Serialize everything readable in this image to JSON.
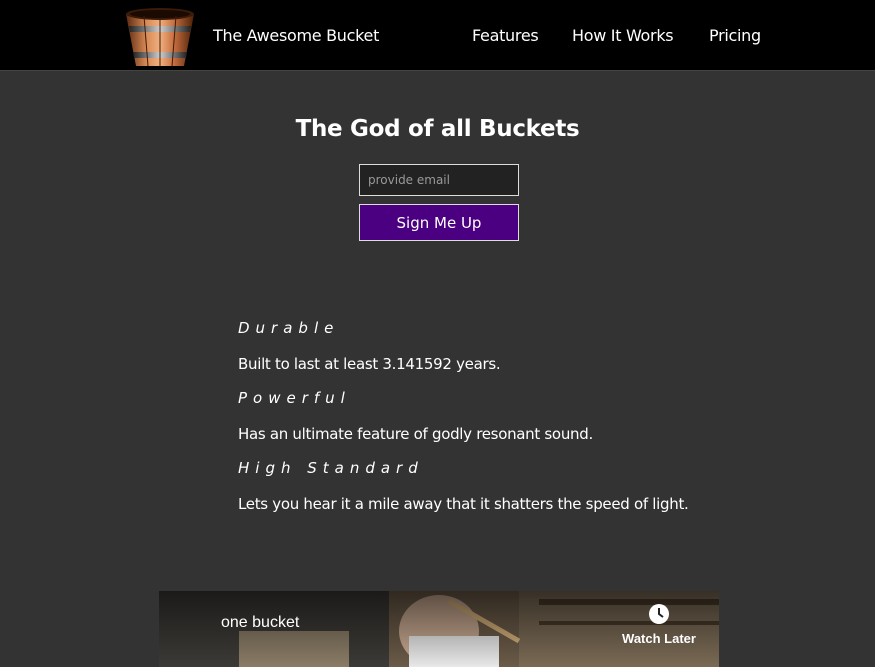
{
  "header": {
    "brand": "The Awesome Bucket",
    "nav": {
      "features": "Features",
      "how_it_works": "How It Works",
      "pricing": "Pricing"
    }
  },
  "hero": {
    "title": "The God of all Buckets",
    "email_placeholder": "provide email",
    "signup_label": "Sign Me Up"
  },
  "features": [
    {
      "heading": "Durable",
      "text": "Built to last at least 3.141592 years."
    },
    {
      "heading": "Powerful",
      "text": "Has an ultimate feature of godly resonant sound."
    },
    {
      "heading": "High Standard",
      "text": "Lets you hear it a mile away that it shatters the speed of light."
    }
  ],
  "video": {
    "title": "one bucket",
    "watch_later": "Watch Later"
  },
  "colors": {
    "background": "#333333",
    "header": "#000000",
    "button": "#4b0082"
  },
  "icons": {
    "logo": "bucket-logo-icon",
    "watch_later": "clock-icon"
  }
}
